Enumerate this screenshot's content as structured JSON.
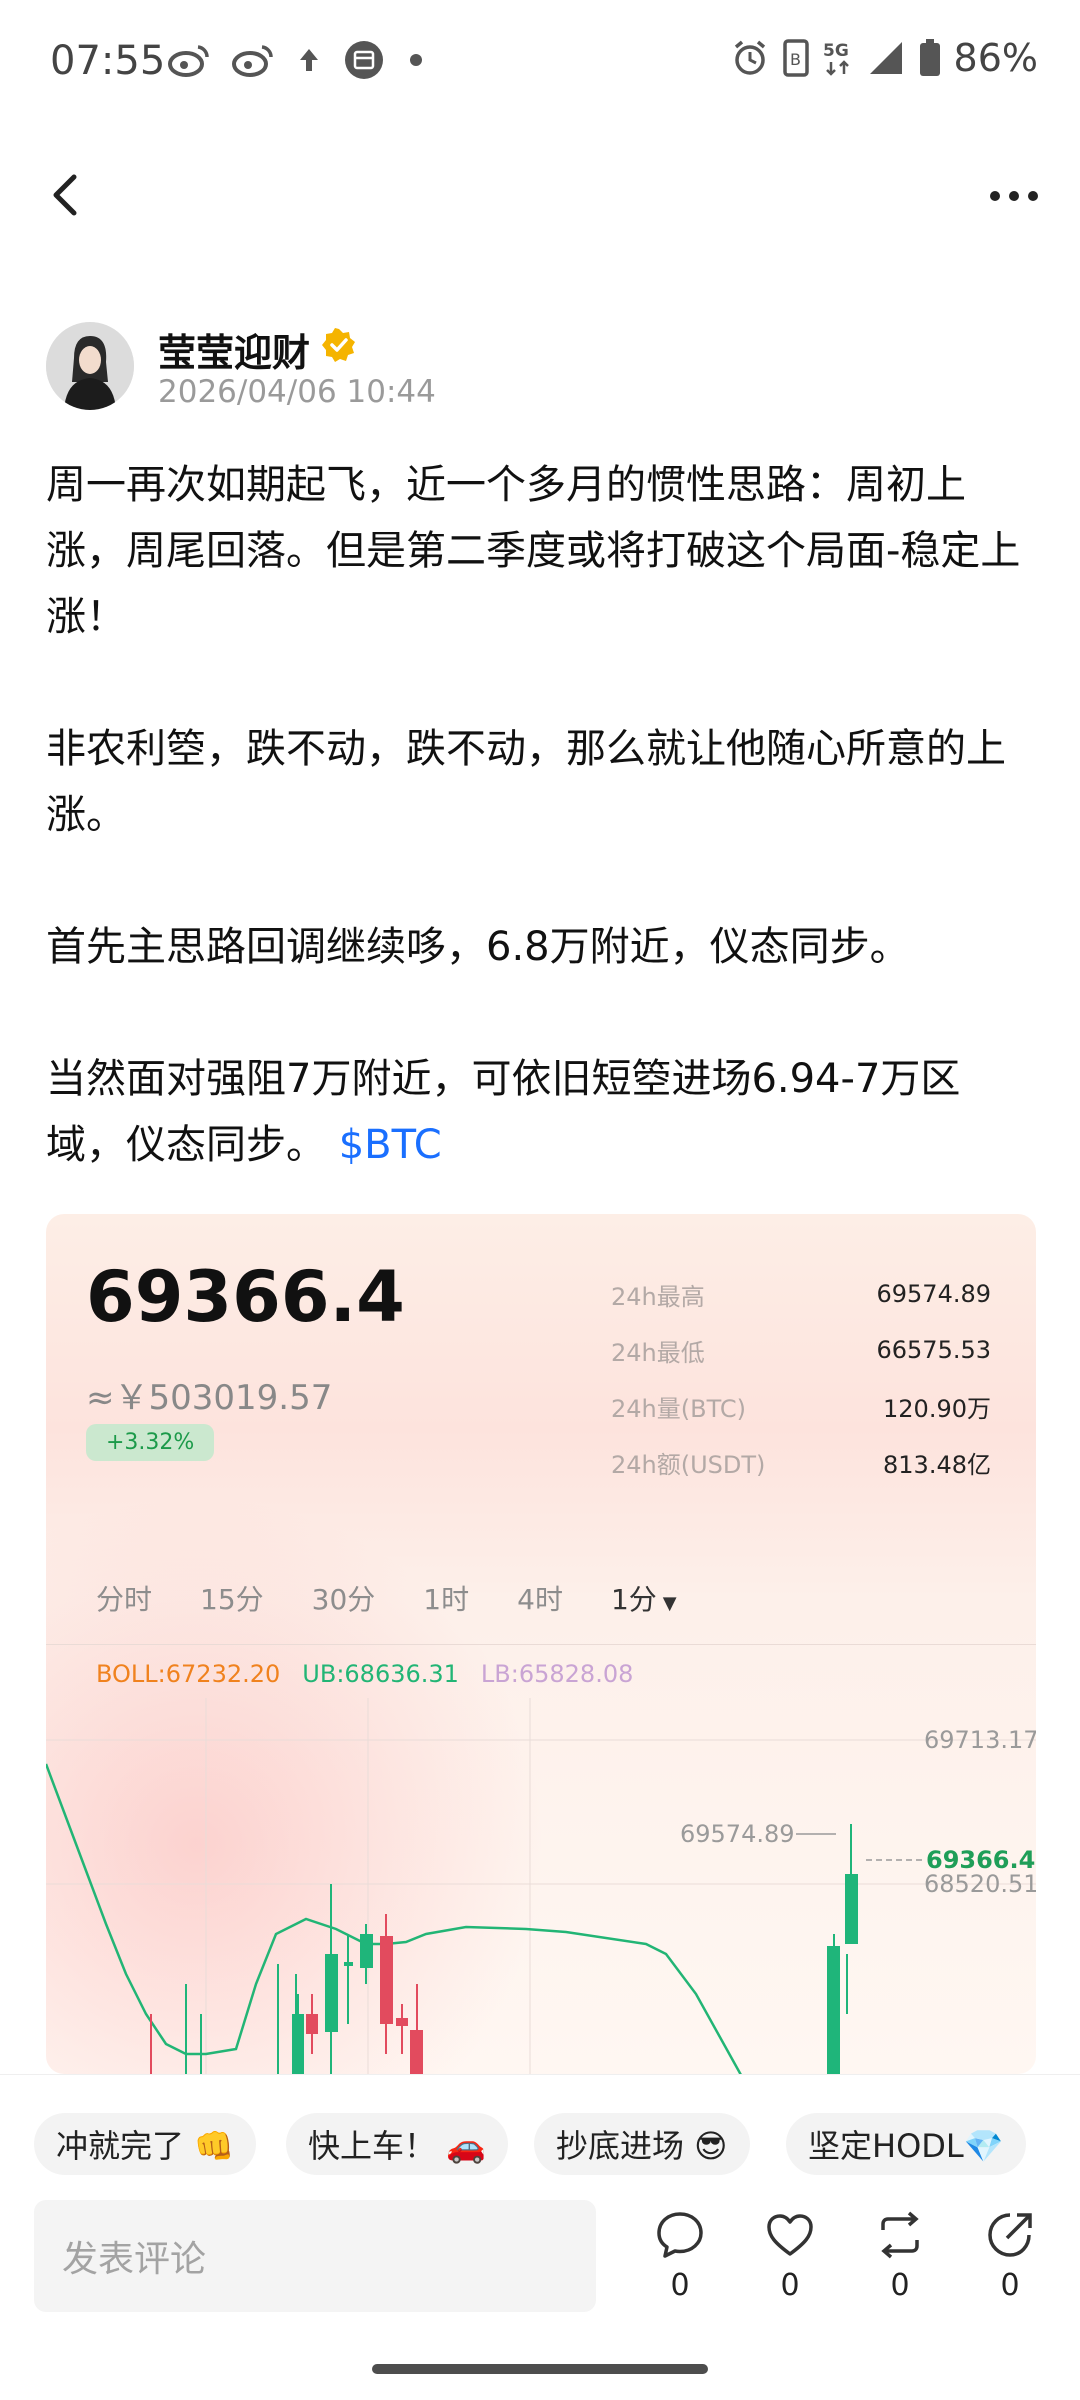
{
  "status_bar": {
    "time": "07:55",
    "battery": "86%",
    "network": "5G",
    "icons_left": [
      "weibo-icon",
      "weibo-icon",
      "upload-arrow-icon",
      "calendar-icon",
      "dot-icon"
    ],
    "icons_right": [
      "alarm-icon",
      "sim-icon",
      "5g-icon",
      "signal-icon",
      "battery-icon"
    ]
  },
  "nav": {
    "back_icon": "chevron-left-icon",
    "more_icon": "more-dots-icon"
  },
  "author": {
    "name": "莹莹迎财",
    "verified_color": "#f5b400",
    "time": "2026/04/06 10:44"
  },
  "post": {
    "p1": "周一再次如期起飞，近一个多月的惯性思路：周初上涨，周尾回落。但是第二季度或将打破这个局面-稳定上涨！",
    "p2": "非农利箜，跌不动，跌不动，那么就让他随心所意的上涨。",
    "p3": "首先主思路回调继续哆，6.8万附近，仪态同步。",
    "p4_text": "当然面对强阻7万附近，可依旧短箜进场6.94-7万区域，仪态同步。",
    "cashtag": "$BTC",
    "cashtag_color": "#1a6fff"
  },
  "card": {
    "price": "69366.4",
    "price_cny": "≈￥503019.57",
    "change": "+3.32%",
    "stats": [
      {
        "label": "24h最高",
        "value": "69574.89"
      },
      {
        "label": "24h最低",
        "value": "66575.53"
      },
      {
        "label": "24h量(BTC)",
        "value": "120.90万"
      },
      {
        "label": "24h额(USDT)",
        "value": "813.48亿"
      }
    ],
    "intervals": [
      "分时",
      "15分",
      "30分",
      "1时",
      "4时",
      "1分"
    ],
    "active_interval": "1分",
    "boll": {
      "mid": "BOLL:67232.20",
      "ub": "UB:68636.31",
      "lb": "LB:65828.08"
    }
  },
  "chart_data": {
    "type": "candlestick",
    "y_labels": [
      "69713.17",
      "68520.51"
    ],
    "high_marker": "69574.89",
    "last_price": "69366.40",
    "colors": {
      "up": "#1fb57a",
      "down": "#e24b5e",
      "ub_line": "#22b575"
    }
  },
  "quick_replies": [
    "冲就完了 👊",
    "快上车！ 🚗",
    "抄底进场 😎",
    "坚定HODL💎"
  ],
  "comment": {
    "placeholder": "发表评论",
    "actions": [
      {
        "name": "comment",
        "icon": "comment-bubble-icon",
        "count": "0"
      },
      {
        "name": "like",
        "icon": "heart-icon",
        "count": "0"
      },
      {
        "name": "repost",
        "icon": "repost-icon",
        "count": "0"
      },
      {
        "name": "share",
        "icon": "share-icon",
        "count": "0"
      }
    ]
  }
}
